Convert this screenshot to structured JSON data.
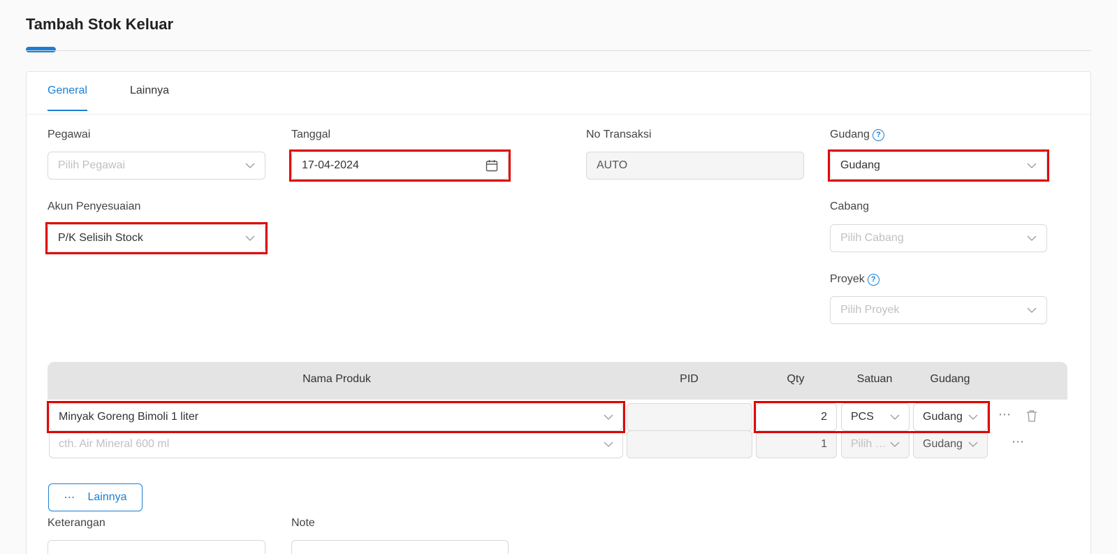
{
  "page": {
    "title": "Tambah Stok Keluar"
  },
  "tabs": [
    {
      "label": "General"
    },
    {
      "label": "Lainnya"
    }
  ],
  "form": {
    "pegawai": {
      "label": "Pegawai",
      "placeholder": "Pilih Pegawai"
    },
    "tanggal": {
      "label": "Tanggal",
      "value": "17-04-2024"
    },
    "no_transaksi": {
      "label": "No Transaksi",
      "value": "AUTO"
    },
    "gudang": {
      "label": "Gudang",
      "value": "Gudang"
    },
    "akun_penyesuaian": {
      "label": "Akun Penyesuaian",
      "value": "P/K Selisih Stock"
    },
    "cabang": {
      "label": "Cabang",
      "placeholder": "Pilih Cabang"
    },
    "proyek": {
      "label": "Proyek",
      "placeholder": "Pilih Proyek"
    },
    "keterangan": {
      "label": "Keterangan"
    },
    "note": {
      "label": "Note"
    }
  },
  "table": {
    "headers": {
      "nama_produk": "Nama Produk",
      "pid": "PID",
      "qty": "Qty",
      "satuan": "Satuan",
      "gudang": "Gudang"
    },
    "rows": [
      {
        "nama_produk": "Minyak Goreng Bimoli 1 liter",
        "pid": "",
        "qty": "2",
        "satuan": "PCS",
        "gudang": "Gudang"
      },
      {
        "nama_produk_placeholder": "cth. Air Mineral 600 ml",
        "pid": "",
        "qty": "1",
        "satuan_placeholder": "Pilih Satuan",
        "gudang": "Gudang"
      }
    ]
  },
  "buttons": {
    "lainnya": "Lainnya"
  },
  "icons": {
    "more": "⋯",
    "help": "?"
  },
  "colors": {
    "accent": "#1a7fd4",
    "highlight": "#e00000"
  }
}
